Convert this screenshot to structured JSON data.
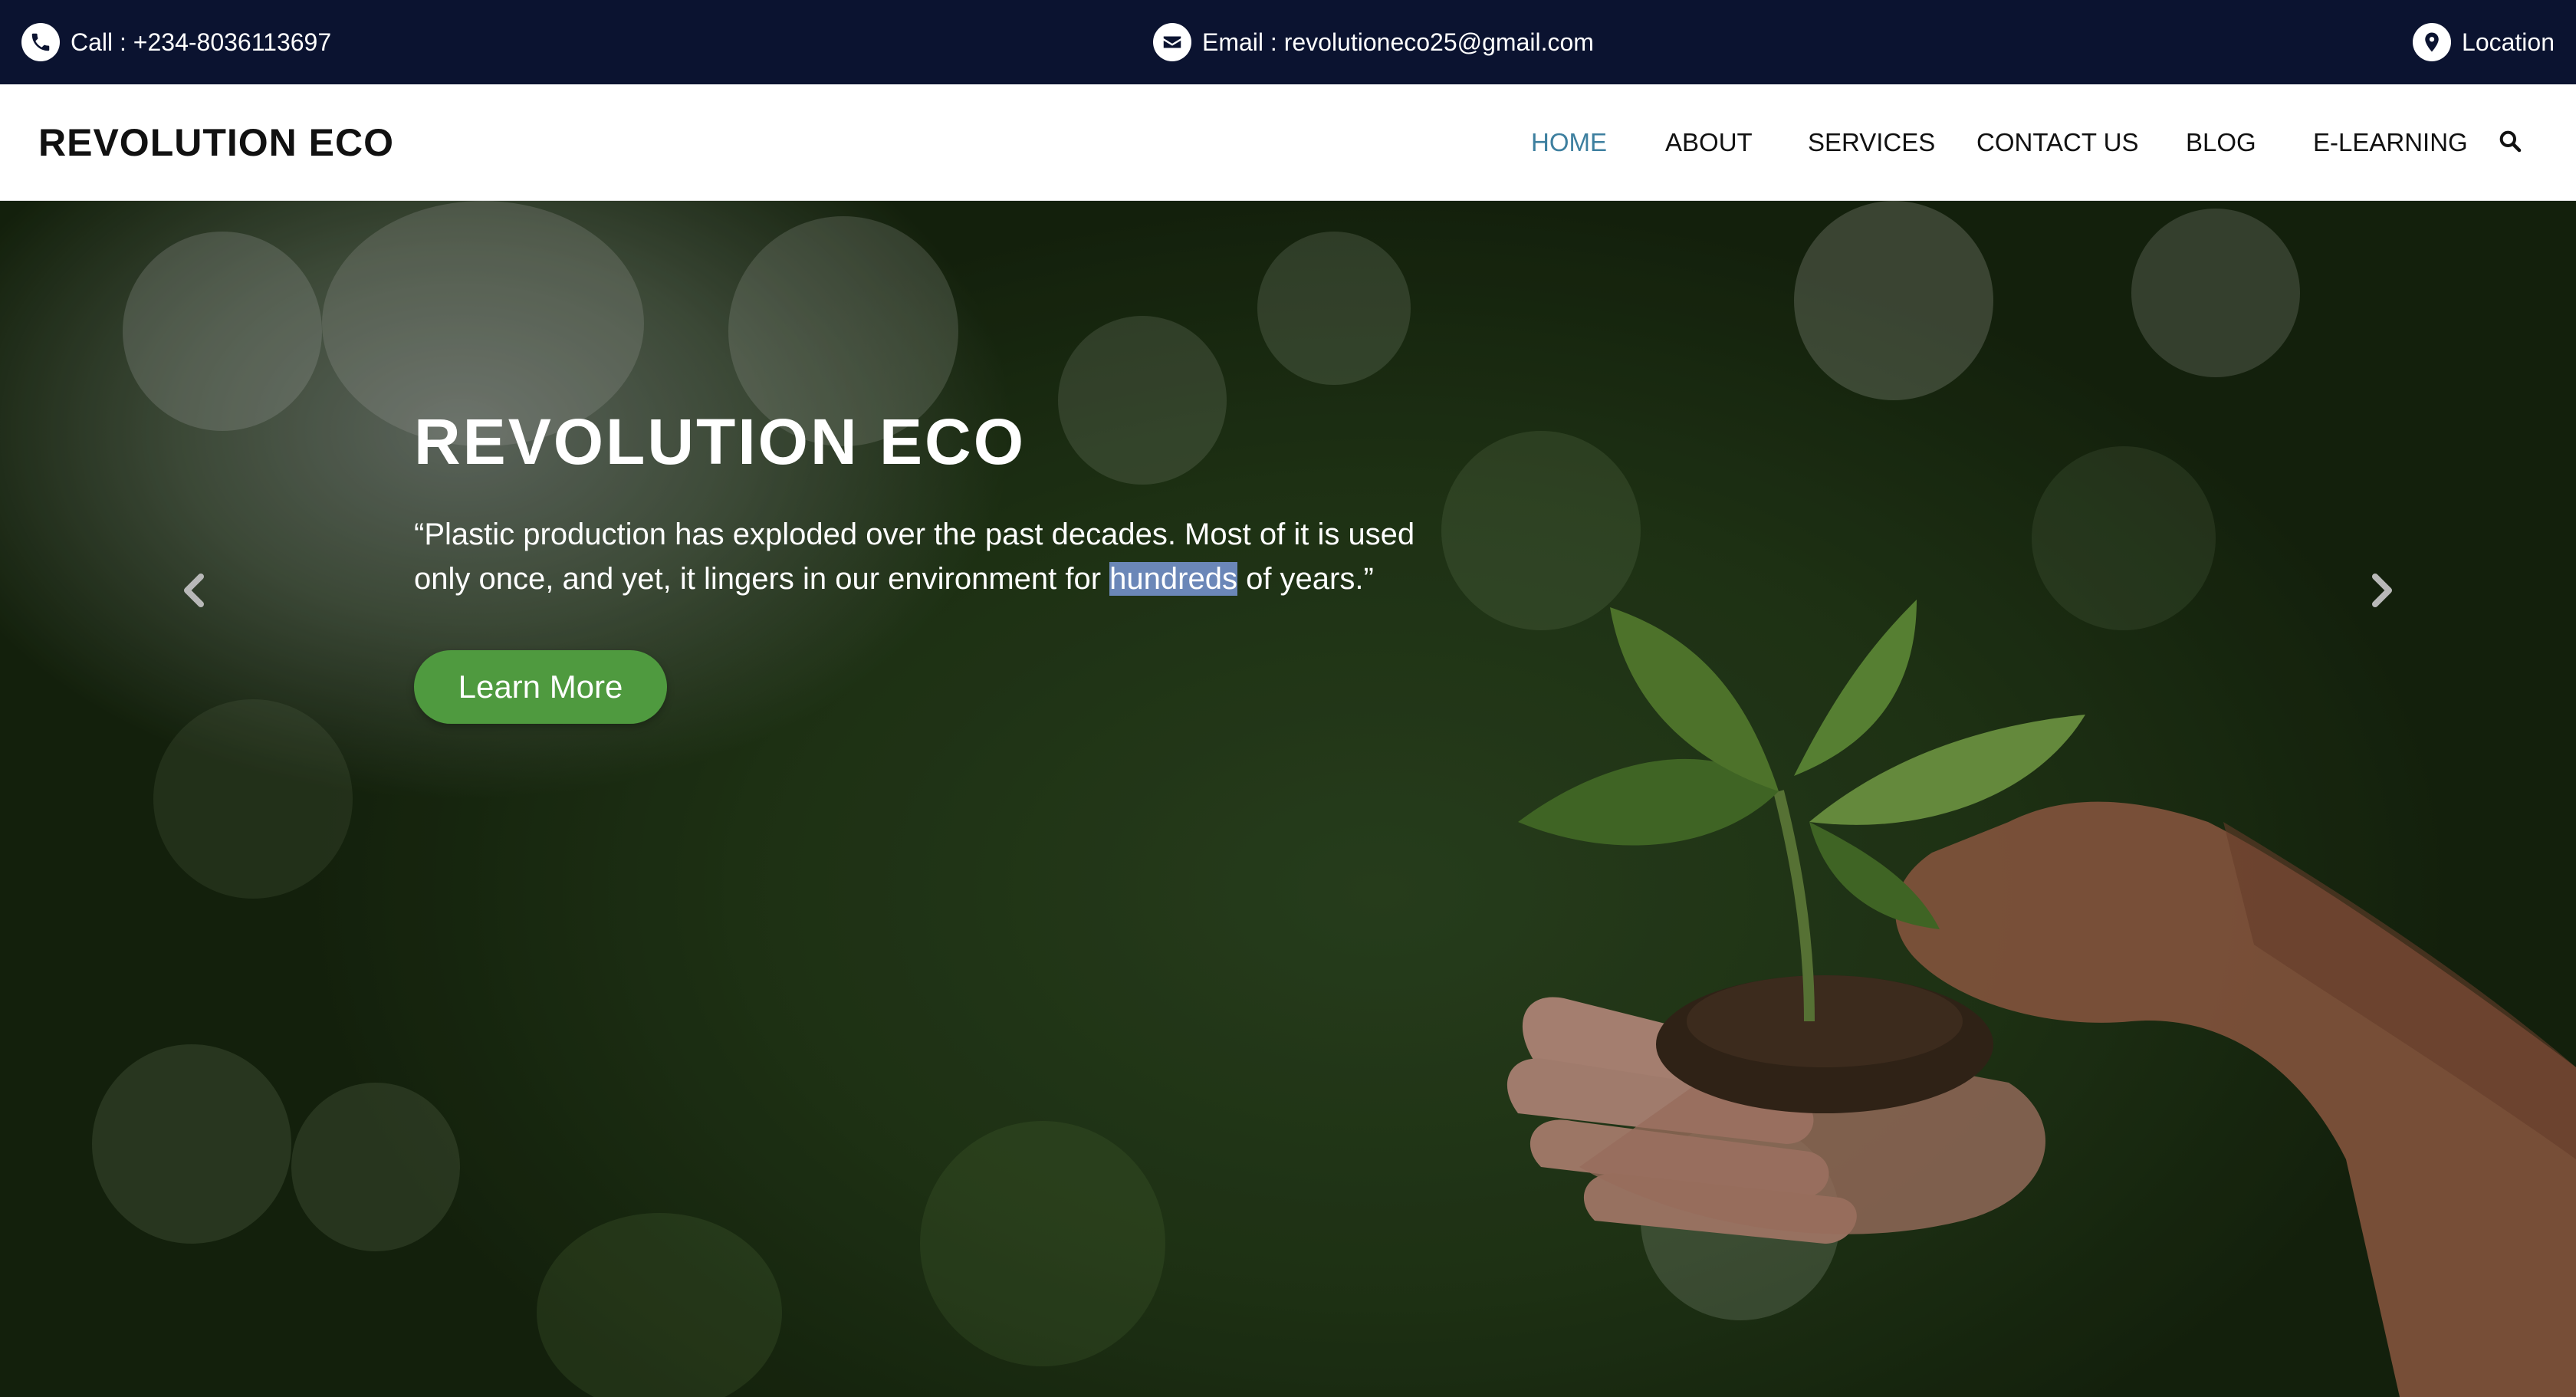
{
  "topbar": {
    "call": "Call : +234-8036113697",
    "email": "Email : revolutioneco25@gmail.com",
    "location": "Location"
  },
  "navbar": {
    "brand": "REVOLUTION ECO",
    "items": [
      {
        "label": "HOME",
        "active": true
      },
      {
        "label": "ABOUT",
        "active": false
      },
      {
        "label": "SERVICES",
        "active": false
      },
      {
        "label": "CONTACT US",
        "active": false
      },
      {
        "label": "BLOG",
        "active": false
      },
      {
        "label": "E-LEARNING",
        "active": false
      }
    ],
    "search_icon": "search-icon"
  },
  "hero": {
    "title": "REVOLUTION ECO",
    "quote_before": "“Plastic production has exploded over the past decades. Most of it is used only once, and yet, it lingers in our environment for ",
    "quote_highlight": "hundreds",
    "quote_after": " of years.”",
    "button_label": "Learn More",
    "prev_icon": "chevron-left-icon",
    "next_icon": "chevron-right-icon"
  },
  "colors": {
    "topbar_bg": "#0b1330",
    "nav_active": "#3d7f9f",
    "button_green": "#4f9a3f",
    "selection": "#6b87b8"
  }
}
